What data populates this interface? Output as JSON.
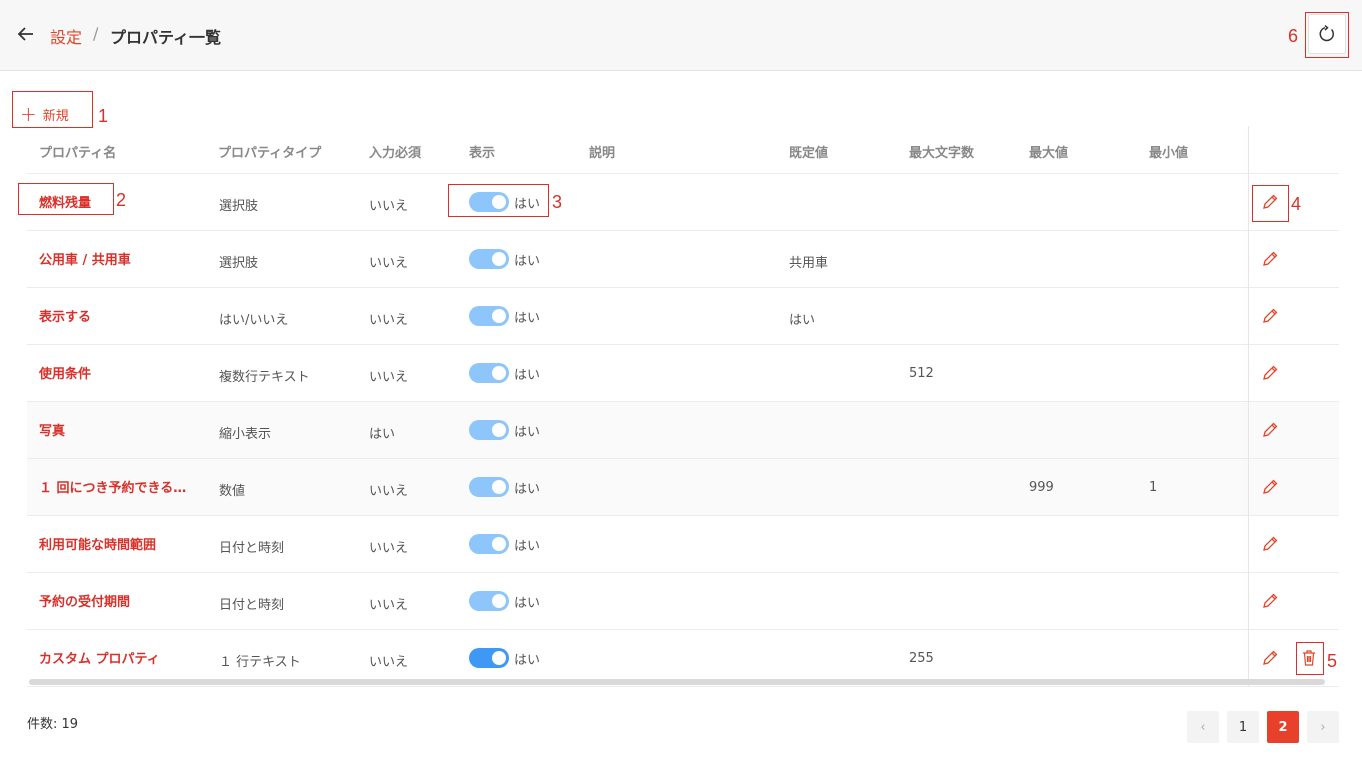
{
  "header": {
    "breadcrumb_link": "設定",
    "breadcrumb_sep": "/",
    "breadcrumb_current": "プロパティ一覧"
  },
  "toolbar": {
    "new_label": "新規",
    "new_icon": "plus-icon"
  },
  "annotations": [
    "1",
    "2",
    "3",
    "4",
    "5",
    "6"
  ],
  "columns": [
    "プロパティ名",
    "プロパティタイプ",
    "入力必須",
    "表示",
    "説明",
    "既定値",
    "最大文字数",
    "最大値",
    "最小値"
  ],
  "rows": [
    {
      "name": "燃料残量",
      "type": "選択肢",
      "required": "いいえ",
      "visible": "はい",
      "default": "",
      "maxlen": "",
      "max": "",
      "min": ""
    },
    {
      "name": "公用車 / 共用車",
      "type": "選択肢",
      "required": "いいえ",
      "visible": "はい",
      "default": "共用車",
      "maxlen": "",
      "max": "",
      "min": ""
    },
    {
      "name": "表示する",
      "type": "はい/いいえ",
      "required": "いいえ",
      "visible": "はい",
      "default": "はい",
      "maxlen": "",
      "max": "",
      "min": ""
    },
    {
      "name": "使用条件",
      "type": "複数行テキスト",
      "required": "いいえ",
      "visible": "はい",
      "default": "",
      "maxlen": "512",
      "max": "",
      "min": ""
    },
    {
      "name": "写真",
      "type": "縮小表示",
      "required": "はい",
      "visible": "はい",
      "default": "",
      "maxlen": "",
      "max": "",
      "min": ""
    },
    {
      "name": "１ 回につき予約できる…",
      "type": "数値",
      "required": "いいえ",
      "visible": "はい",
      "default": "",
      "maxlen": "",
      "max": "999",
      "min": "1"
    },
    {
      "name": "利用可能な時間範囲",
      "type": "日付と時刻",
      "required": "いいえ",
      "visible": "はい",
      "default": "",
      "maxlen": "",
      "max": "",
      "min": ""
    },
    {
      "name": "予約の受付期間",
      "type": "日付と時刻",
      "required": "いいえ",
      "visible": "はい",
      "default": "",
      "maxlen": "",
      "max": "",
      "min": ""
    },
    {
      "name": "カスタム プロパティ",
      "type": "１ 行テキスト",
      "required": "いいえ",
      "visible": "はい",
      "default": "",
      "maxlen": "255",
      "max": "",
      "min": ""
    }
  ],
  "footer": {
    "count_label": "件数: 19"
  },
  "pagination": {
    "prev": "‹",
    "pages": [
      "1",
      "2"
    ],
    "current": "2",
    "next": "›"
  },
  "colors": {
    "accent": "#e0452a",
    "toggle": "#8ec5fb",
    "toggle_active": "#4098f5",
    "annotation": "#d9302a"
  }
}
